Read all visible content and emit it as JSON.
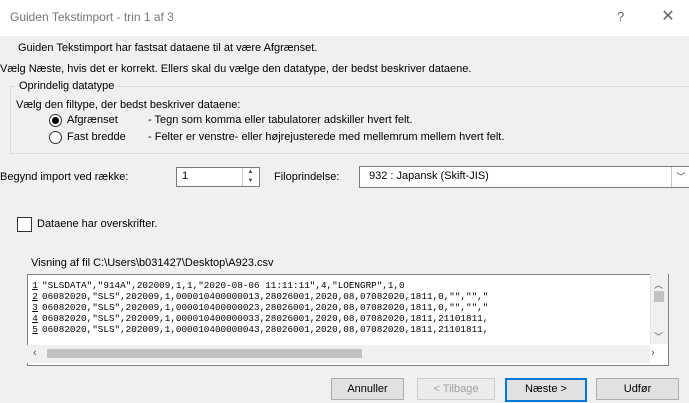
{
  "window": {
    "title": "Guiden Tekstimport - trin 1 af 3",
    "help_glyph": "?",
    "close_glyph": "✕"
  },
  "intro": {
    "line1": "Guiden Tekstimport har fastsat dataene til at være Afgrænset.",
    "line2": "Vælg Næste, hvis det er korrekt. Ellers skal du vælge den datatype, der bedst beskriver dataene."
  },
  "datatype": {
    "legend": "Oprindelig datatype",
    "prompt": "Vælg den filtype, der bedst beskriver dataene:",
    "options": [
      {
        "label": "Afgrænset",
        "description": "- Tegn som komma eller tabulatorer adskiller hvert felt.",
        "selected": true
      },
      {
        "label": "Fast bredde",
        "description": "- Felter er venstre- eller højrejusterede med mellemrum mellem hvert felt.",
        "selected": false
      }
    ]
  },
  "start_row": {
    "label": "Begynd import ved række:",
    "value": "1"
  },
  "file_origin": {
    "label": "Filoprindelse:",
    "value": "932 : Japansk (Skift-JIS)"
  },
  "headers_checkbox": {
    "label": "Dataene har overskrifter.",
    "checked": false
  },
  "preview": {
    "label": "Visning af fil C:\\Users\\b031427\\Desktop\\A923.csv",
    "rows": [
      {
        "num": "1",
        "text": "\"SLSDATA\",\"914A\",202009,1,1,\"2020-08-06 11:11:11\",4,\"LOENGRP\",1,0"
      },
      {
        "num": "2",
        "text": "06082020,\"SLS\",202009,1,000010400000013,28026001,2020,08,07082020,1811,0,\"\",\"\",\""
      },
      {
        "num": "3",
        "text": "06082020,\"SLS\",202009,1,000010400000023,28026001,2020,08,07082020,1811,0,\"\",\"\",\""
      },
      {
        "num": "4",
        "text": "06082020,\"SLS\",202009,1,000010400000033,28026001,2020,08,07082020,1811,21101811,"
      },
      {
        "num": "5",
        "text": "06082020,\"SLS\",202009,1,000010400000043,28026001,2020,08,07082020,1811,21101811,"
      }
    ]
  },
  "buttons": {
    "cancel": "Annuller",
    "back": "< Tilbage",
    "next": "Næste >",
    "finish": "Udfør"
  }
}
